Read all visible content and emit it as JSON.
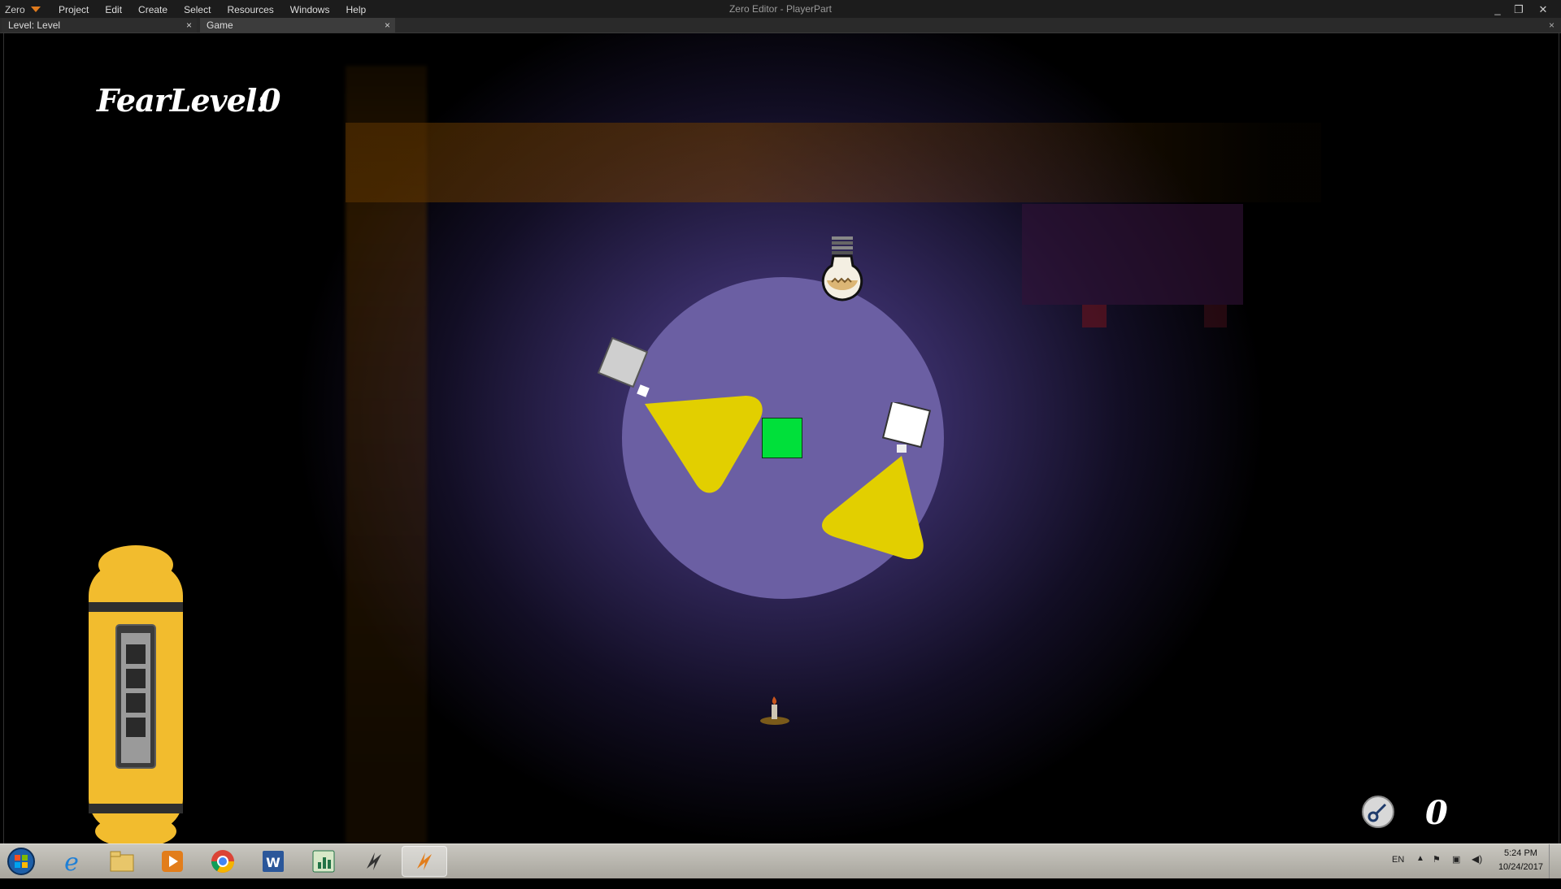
{
  "app": {
    "logo": "Zero",
    "window_title": "Zero Editor - PlayerPart"
  },
  "menu": [
    "Project",
    "Edit",
    "Create",
    "Select",
    "Resources",
    "Windows",
    "Help"
  ],
  "window_controls": {
    "minimize": "_",
    "restore": "❐",
    "close": "✕"
  },
  "tabs": [
    {
      "label": "Level: Level",
      "close": "×"
    },
    {
      "label": "Game",
      "close": "×"
    }
  ],
  "tabbar_close": "×",
  "game": {
    "fear_label": "FearLevel:",
    "fear_value": "0",
    "key_count": "0"
  },
  "taskbar": {
    "apps": [
      "start-orb",
      "internet-explorer",
      "file-explorer",
      "media-player",
      "chrome",
      "word",
      "excel",
      "zero-editor",
      "zero-editor-game"
    ],
    "language": "EN",
    "time": "5:24 PM",
    "date": "10/24/2017"
  },
  "colors": {
    "menubar": "#1c1c1c",
    "light_circle": "#6b5fa3",
    "spotlight": "#e2cf00",
    "player": "#00e03a",
    "battery": "#f2bc2e"
  }
}
